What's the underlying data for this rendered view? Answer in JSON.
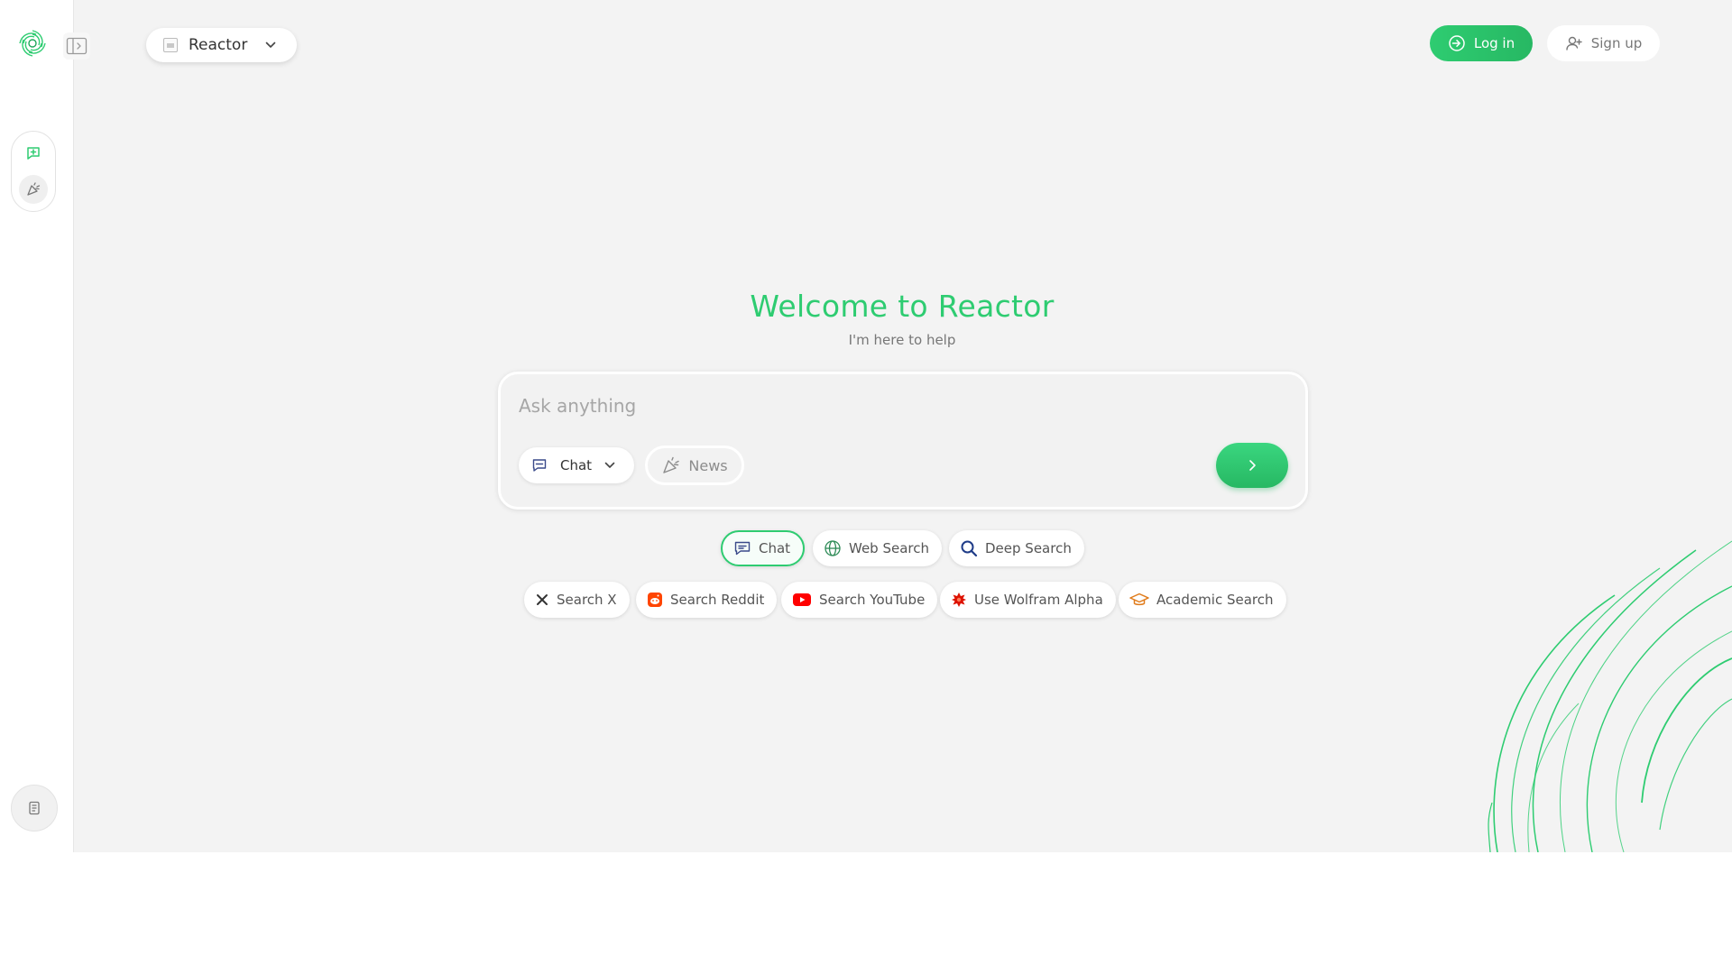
{
  "header": {
    "model_selector": {
      "label": "Reactor",
      "icon": "chevron-down-icon"
    },
    "login_label": "Log in",
    "signup_label": "Sign up"
  },
  "sidebar": {
    "items": [
      {
        "name": "new-chat",
        "icon": "chat-plus-icon"
      },
      {
        "name": "news",
        "icon": "party-popper-icon"
      }
    ],
    "bottom_icon": "document-icon"
  },
  "main": {
    "title": "Welcome to Reactor",
    "subtitle": "I'm here to help",
    "search": {
      "placeholder": "Ask anything",
      "mode_label": "Chat",
      "news_label": "News"
    },
    "mode_chips": [
      {
        "label": "Chat",
        "icon": "chat-icon",
        "active": true
      },
      {
        "label": "Web Search",
        "icon": "globe-icon",
        "active": false
      },
      {
        "label": "Deep Search",
        "icon": "search-icon",
        "active": false
      }
    ],
    "source_chips": [
      {
        "label": "Search X",
        "icon": "x-icon"
      },
      {
        "label": "Search Reddit",
        "icon": "reddit-icon"
      },
      {
        "label": "Search YouTube",
        "icon": "youtube-icon"
      },
      {
        "label": "Use Wolfram Alpha",
        "icon": "wolfram-icon"
      },
      {
        "label": "Academic Search",
        "icon": "graduation-cap-icon"
      }
    ]
  },
  "colors": {
    "accent": "#2ecc71",
    "background": "#f3f3f3",
    "sidebar": "#ffffff"
  }
}
